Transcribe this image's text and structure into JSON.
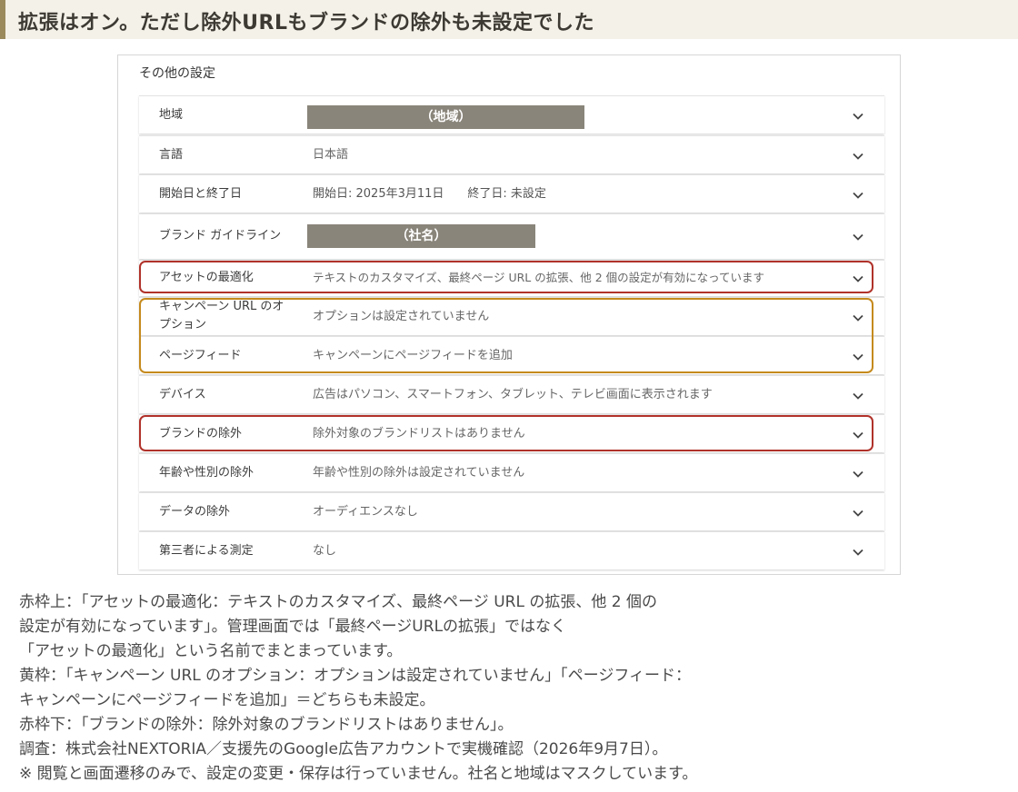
{
  "heading": "拡張はオン。ただし除外URLもブランドの除外も未設定でした",
  "panel": {
    "title": "その他の設定",
    "rows": [
      {
        "label": "地域",
        "mask": "（地域）"
      },
      {
        "label": "言語",
        "value": "日本語"
      },
      {
        "label": "開始日と終了日",
        "value": "開始日: 2025年3月11日　　終了日: 未設定"
      },
      {
        "label": "ブランド ガイドライン",
        "mask": "（社名）"
      },
      {
        "label": "アセットの最適化",
        "value": "テキストのカスタマイズ、最終ページ URL の拡張、他 2 個の設定が有効になっています"
      },
      {
        "label": "キャンペーン URL のオプション",
        "value": "オプションは設定されていません"
      },
      {
        "label": "ページフィード",
        "value": "キャンペーンにページフィードを追加"
      },
      {
        "label": "デバイス",
        "value": "広告はパソコン、スマートフォン、タブレット、テレビ画面に表示されます"
      },
      {
        "label": "ブランドの除外",
        "value": "除外対象のブランドリストはありません"
      },
      {
        "label": "年齢や性別の除外",
        "value": "年齢や性別の除外は設定されていません"
      },
      {
        "label": "データの除外",
        "value": "オーディエンスなし"
      },
      {
        "label": "第三者による測定",
        "value": "なし"
      }
    ]
  },
  "icons": {
    "row_toggle": "chevron-down-icon"
  },
  "colors": {
    "highlight_red": "#b0322a",
    "highlight_amber": "#c58a1d",
    "mask": "#8a857a"
  },
  "notes": [
    "赤枠上：「アセットの最適化：テキストのカスタマイズ、最終ページ URL の拡張、他 2 個の",
    "設定が有効になっています」。管理画面では「最終ページURLの拡張」ではなく",
    "「アセットの最適化」という名前でまとまっています。",
    "黄枠：「キャンペーン URL のオプション：オプションは設定されていません」「ページフィード：",
    "キャンペーンにページフィードを追加」＝どちらも未設定。",
    "赤枠下：「ブランドの除外：除外対象のブランドリストはありません」。",
    "調査：株式会社NEXTORIA／支援先のGoogle広告アカウントで実機確認（2026年9月7日）。",
    "※ 閲覧と画面遷移のみで、設定の変更・保存は行っていません。社名と地域はマスクしています。"
  ]
}
